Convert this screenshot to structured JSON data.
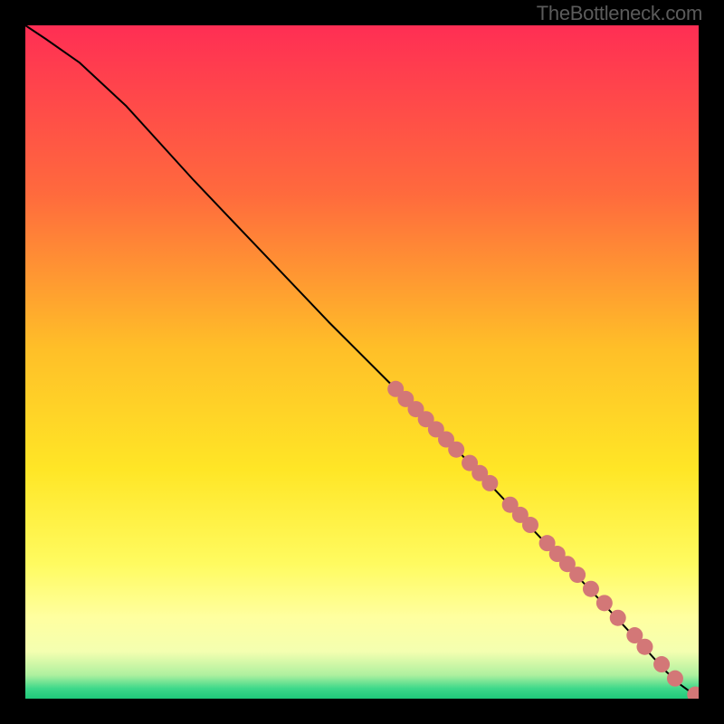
{
  "watermark": "TheBottleneck.com",
  "chart_data": {
    "type": "line",
    "title": "",
    "xlabel": "",
    "ylabel": "",
    "xlim": [
      0,
      100
    ],
    "ylim": [
      0,
      100
    ],
    "grid": false,
    "legend": false,
    "background_gradient_stops": [
      {
        "offset": 0.0,
        "color": "#ff2e54"
      },
      {
        "offset": 0.25,
        "color": "#ff6a3d"
      },
      {
        "offset": 0.48,
        "color": "#ffbf28"
      },
      {
        "offset": 0.66,
        "color": "#ffe626"
      },
      {
        "offset": 0.8,
        "color": "#fffb60"
      },
      {
        "offset": 0.88,
        "color": "#ffffa0"
      },
      {
        "offset": 0.93,
        "color": "#f4ffb0"
      },
      {
        "offset": 0.965,
        "color": "#aef09f"
      },
      {
        "offset": 0.985,
        "color": "#3dd88a"
      },
      {
        "offset": 1.0,
        "color": "#1fc97a"
      }
    ],
    "series": [
      {
        "name": "curve",
        "type": "line",
        "x": [
          0,
          3,
          8,
          15,
          25,
          35,
          45,
          55,
          65,
          75,
          85,
          92,
          95,
          97,
          98.5,
          100,
          100.3
        ],
        "y": [
          100,
          98,
          94.5,
          88,
          77,
          66.5,
          56,
          46,
          36,
          25.5,
          15,
          7.5,
          4.2,
          2.3,
          1.2,
          0.6,
          0.6
        ]
      },
      {
        "name": "dots",
        "type": "scatter",
        "color": "#d37777",
        "x": [
          55,
          56.5,
          58,
          59.5,
          61,
          62.5,
          64,
          66,
          67.5,
          69,
          72,
          73.5,
          75,
          77.5,
          79,
          80.5,
          82,
          84,
          86,
          88,
          90.5,
          92,
          94.5,
          96.5,
          99.5,
          101
        ],
        "y": [
          46,
          44.5,
          43,
          41.5,
          40,
          38.5,
          37,
          35,
          33.5,
          32,
          28.8,
          27.3,
          25.8,
          23.1,
          21.5,
          20,
          18.4,
          16.3,
          14.2,
          12,
          9.4,
          7.7,
          5.1,
          3.0,
          0.6,
          0.6
        ]
      }
    ]
  }
}
